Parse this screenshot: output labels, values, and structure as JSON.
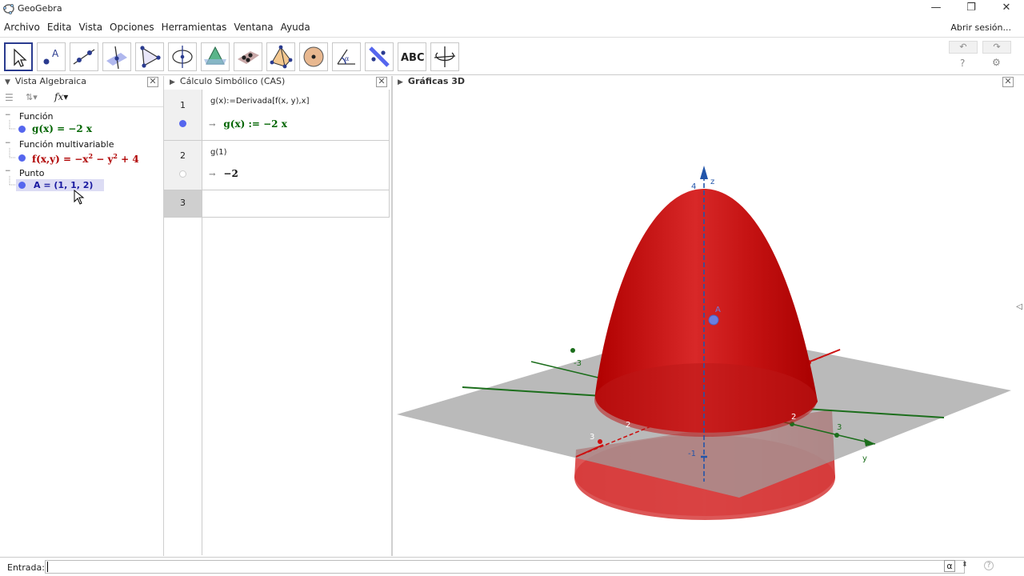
{
  "window": {
    "title": "GeoGebra",
    "minimize": "—",
    "maximize": "❐",
    "close": "✕"
  },
  "menu": {
    "items": [
      "Archivo",
      "Edita",
      "Vista",
      "Opciones",
      "Herramientas",
      "Ventana",
      "Ayuda"
    ],
    "login": "Abrir sesión..."
  },
  "toolbar": {
    "tools": [
      "move-tool",
      "point-tool",
      "line-tool",
      "perpendicular-tool",
      "polygon-tool",
      "circle-tool",
      "intersect-surfaces-tool",
      "plane-tool",
      "pyramid-tool",
      "sphere-tool",
      "angle-tool",
      "reflect-tool",
      "text-tool",
      "rotate-view-tool"
    ],
    "text_tool_label": "ABC",
    "undo": "↶",
    "redo": "↷",
    "help": "?",
    "settings": "⚙"
  },
  "algebra": {
    "header": "Vista Algebraica",
    "fx_label": "fx",
    "categories": [
      {
        "label": "Función",
        "expr": "g(x) = −2 x",
        "color": "#006400"
      },
      {
        "label": "Función multivariable",
        "expr_parts": [
          "f(x,y) = −x",
          "2",
          " − y",
          "2",
          " + 4"
        ],
        "color": "#b00000"
      },
      {
        "label": "Punto",
        "expr": "A = (1, 1, 2)",
        "color": "#1a1aa0"
      }
    ]
  },
  "cas": {
    "header": "Cálculo Simbólico (CAS)",
    "rows": [
      {
        "num": "1",
        "input": "g(x):=Derivada[f(x, y),x]",
        "arrow": "→",
        "output": "g(x) := −2 x"
      },
      {
        "num": "2",
        "input": "g(1)",
        "arrow": "→",
        "output": "−2"
      },
      {
        "num": "3",
        "input": "",
        "output": ""
      }
    ]
  },
  "graphics3d": {
    "header": "Gráficas 3D",
    "axis_labels": {
      "z": "z",
      "y": "y"
    },
    "ticks": {
      "z4": "4",
      "zm1": "-1",
      "xm3": "-3",
      "x2": "2",
      "x3": "3",
      "y2": "2",
      "y3": "3",
      "ym3": "-3"
    },
    "point_label": "A",
    "colors": {
      "surface": "#cc1111",
      "plane": "#9a9a9a",
      "point": "#6a7fe0"
    }
  },
  "input_bar": {
    "label": "Entrada:",
    "alpha": "α",
    "help": "?"
  }
}
